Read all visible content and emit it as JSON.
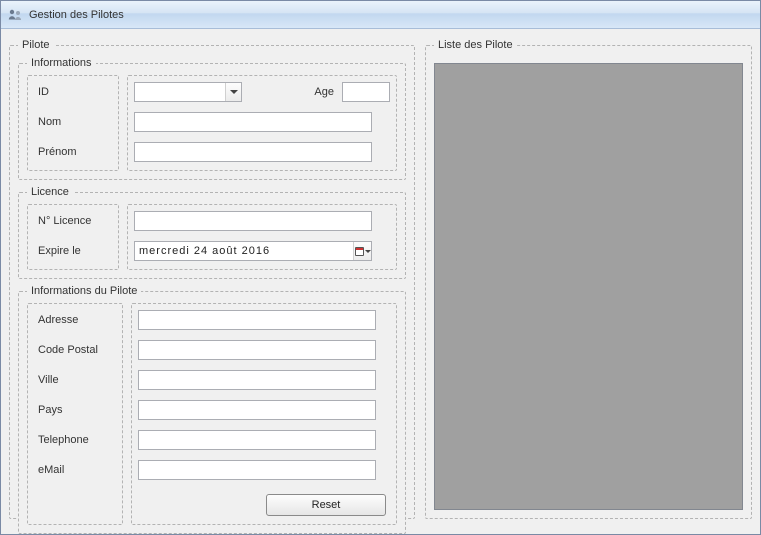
{
  "window": {
    "title": "Gestion des Pilotes"
  },
  "pilote_group": {
    "legend": "Pilote"
  },
  "informations_group": {
    "legend": "Informations",
    "id_label": "ID",
    "nom_label": "Nom",
    "prenom_label": "Prénom",
    "age_label": "Age",
    "id_value": "",
    "age_value": "",
    "nom_value": "",
    "prenom_value": ""
  },
  "licence_group": {
    "legend": "Licence",
    "num_label": "N° Licence",
    "expire_label": "Expire le",
    "num_value": "",
    "expire_value": "mercredi  24      août       2016"
  },
  "details_group": {
    "legend": "Informations du Pilote",
    "adresse_label": "Adresse",
    "cp_label": "Code Postal",
    "ville_label": "Ville",
    "pays_label": "Pays",
    "tel_label": "Telephone",
    "email_label": "eMail",
    "adresse_value": "",
    "cp_value": "",
    "ville_value": "",
    "pays_value": "",
    "tel_value": "",
    "email_value": "",
    "reset_label": "Reset"
  },
  "list_group": {
    "legend": "Liste des Pilote"
  }
}
